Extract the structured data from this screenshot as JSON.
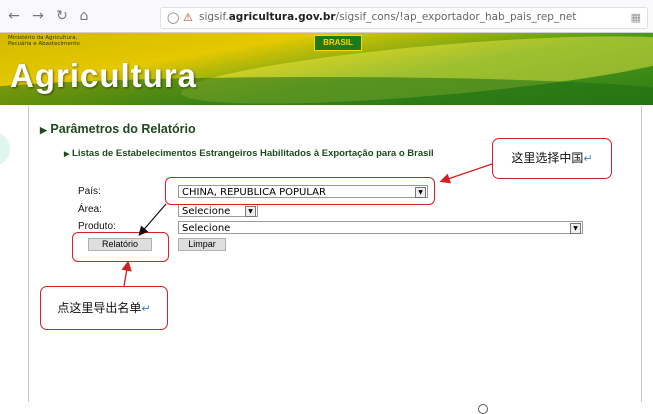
{
  "browser": {
    "back_glyph": "←",
    "forward_glyph": "→",
    "reload_glyph": "↻",
    "home_glyph": "⌂",
    "url_prefix": "sigsif.",
    "url_domain": "agricultura.gov.br",
    "url_path": "/sigsif_cons/!ap_exportador_hab_pais_rep_net"
  },
  "banner": {
    "ministry_line1": "Ministério da Agricultura,",
    "ministry_line2": "Pecuária e Abastecimento",
    "brasil_logo": "BRASIL",
    "site_title": "Agricultura"
  },
  "page": {
    "section_title": "Parâmetros do Relatório",
    "subtitle": "Listas de Estabelecimentos Estrangeiros Habilitados à Exportação para o Brasil"
  },
  "form": {
    "pais_label": "País:",
    "pais_value": "CHINA, REPUBLICA POPULAR",
    "area_label": "Área:",
    "area_value": "Selecione",
    "produto_label": "Produto:",
    "produto_value": "Selecione",
    "relatorio_button": "Relatório",
    "limpar_button": "Limpar"
  },
  "annotations": {
    "select_china_note": "这里选择中国",
    "export_list_note": "点这里导出名单",
    "return_glyph": "↵"
  },
  "colors": {
    "heading_green": "#1e4a1e",
    "callout_red": "#d42020"
  }
}
